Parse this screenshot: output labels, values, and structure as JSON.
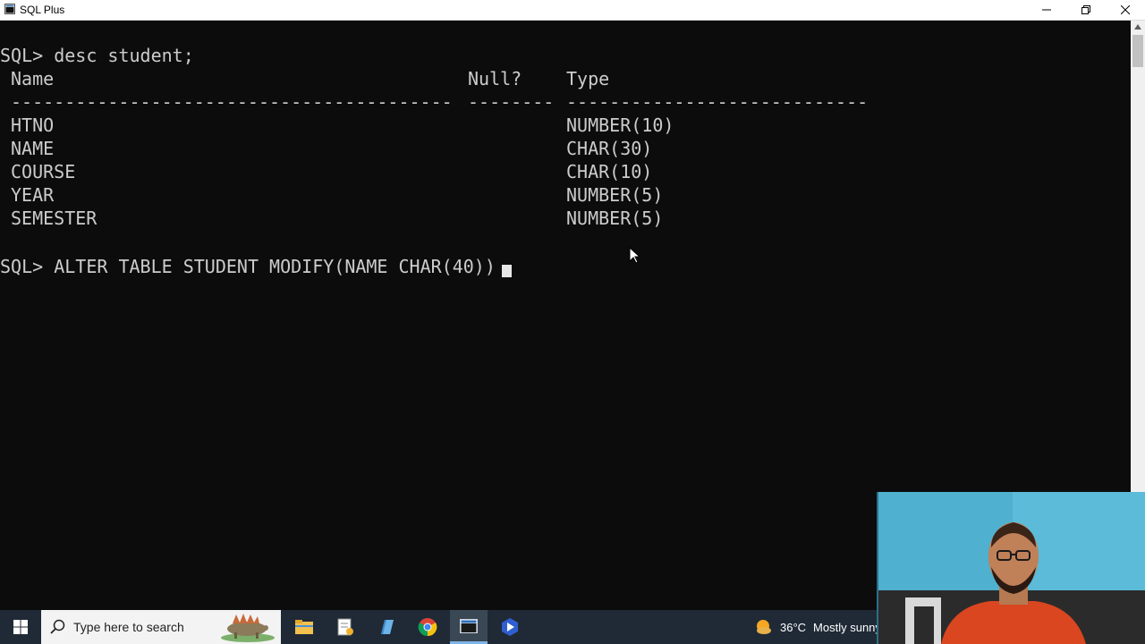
{
  "window": {
    "title": "SQL Plus"
  },
  "terminal": {
    "prompt": "SQL>",
    "command1": "SQL> desc student;",
    "header": {
      "name": "Name",
      "null": "Null?",
      "type": "Type"
    },
    "separator": {
      "name": "-----------------------------------------",
      "null": "--------",
      "type": "----------------------------"
    },
    "rows": [
      {
        "name": "HTNO",
        "type": "NUMBER(10)"
      },
      {
        "name": "NAME",
        "type": "CHAR(30)"
      },
      {
        "name": "COURSE",
        "type": "CHAR(10)"
      },
      {
        "name": "YEAR",
        "type": "NUMBER(5)"
      },
      {
        "name": "SEMESTER",
        "type": "NUMBER(5)"
      }
    ],
    "command2": "SQL> ALTER TABLE STUDENT MODIFY(NAME CHAR(40))"
  },
  "taskbar": {
    "search_placeholder": "Type here to search",
    "weather_temp": "36°C",
    "weather_text": "Mostly sunny",
    "apps": [
      "start-icon",
      "file-explorer-icon",
      "notepad-icon",
      "app-icon",
      "chrome-icon",
      "sql-plus-icon",
      "app-blue-icon"
    ]
  },
  "colors": {
    "terminal_bg": "#0c0c0c",
    "terminal_text": "#cccccc",
    "taskbar_bg": "#1f2a36"
  }
}
